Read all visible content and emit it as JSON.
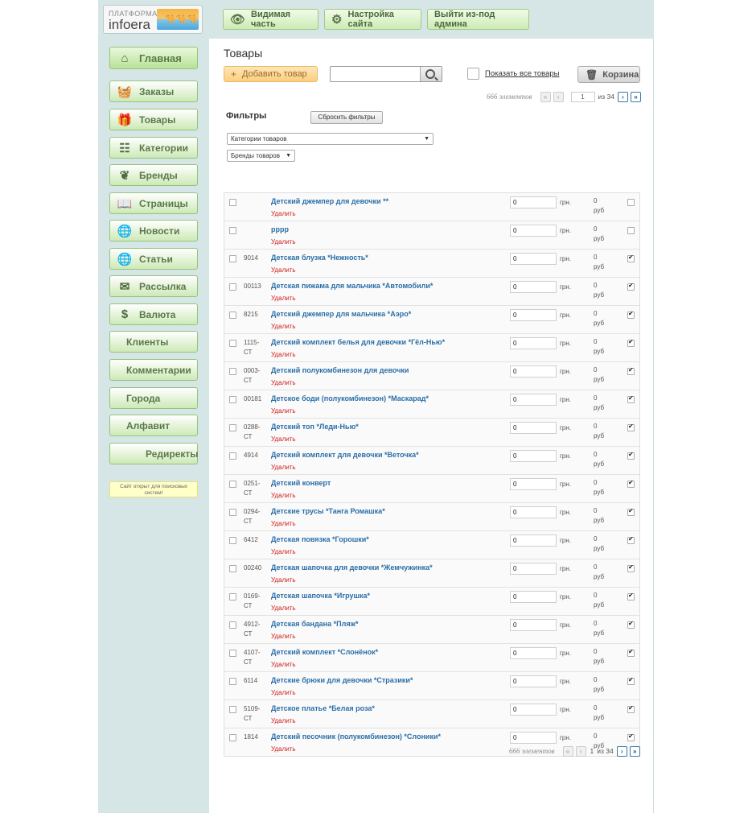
{
  "logo": {
    "line1": "ПЛАТФОРМА",
    "line2": "infoera"
  },
  "topbar": {
    "visible_label": "Видимая часть",
    "settings_label": "Настройка сайта",
    "logout_label": "Выйти из-под админа"
  },
  "sidebar": {
    "items": [
      {
        "label": "Главная",
        "icon": "home-icon"
      },
      {
        "label": "Заказы",
        "icon": "basket-icon"
      },
      {
        "label": "Товары",
        "icon": "gift-icon"
      },
      {
        "label": "Категории",
        "icon": "tree-icon"
      },
      {
        "label": "Бренды",
        "icon": "leaf-icon"
      },
      {
        "label": "Страницы",
        "icon": "book-icon"
      },
      {
        "label": "Новости",
        "icon": "globe-icon"
      },
      {
        "label": "Статьи",
        "icon": "globe-icon"
      },
      {
        "label": "Рассылка",
        "icon": "envelope-icon"
      },
      {
        "label": "Валюта",
        "icon": "dollar-icon"
      },
      {
        "label": "Клиенты"
      },
      {
        "label": "Комментарии"
      },
      {
        "label": "Города"
      },
      {
        "label": "Алфавит"
      },
      {
        "label": "Редиректы"
      }
    ],
    "seo_notice": "Сайт открыт для поисковых систем!"
  },
  "main": {
    "title": "Товары",
    "add_label": "Добавить товар",
    "search_value": "",
    "show_all_label": "Показать все товары",
    "cart_label": "Корзина",
    "pager_top": {
      "count": "666 элементов",
      "page": "1",
      "of": "из 34"
    },
    "pager_bottom": {
      "count": "666 элементов",
      "page": "1",
      "of": "из 34"
    },
    "pager_glyphs": {
      "first": "«",
      "prev": "‹",
      "next": "›",
      "last": "»"
    },
    "filters_title": "Фильтры",
    "reset_label": "Сбросить фильтры",
    "categories_select": "Категории товаров",
    "brands_select": "Бренды товаров",
    "delete_label": "Удалить",
    "currency1": "грн.",
    "currency2": "руб",
    "products": [
      {
        "sku": "",
        "name": "Детский джемпер для девочки **",
        "price": "0",
        "rub": "0",
        "checked": false
      },
      {
        "sku": "",
        "name": "рррр",
        "price": "0",
        "rub": "0",
        "checked": false
      },
      {
        "sku": "9014",
        "name": "Детская блузка *Нежность*",
        "price": "0",
        "rub": "0",
        "checked": true
      },
      {
        "sku": "00113",
        "name": "Детская пижама для мальчика *Автомобили*",
        "price": "0",
        "rub": "0",
        "checked": true
      },
      {
        "sku": "8215",
        "name": "Детский джемпер для мальчика *Аэро*",
        "price": "0",
        "rub": "0",
        "checked": true
      },
      {
        "sku": "1115-СТ",
        "name": "Детский комплект белья для девочки *Гёл-Нью*",
        "price": "0",
        "rub": "0",
        "checked": true
      },
      {
        "sku": "0003-СТ",
        "name": "Детский полукомбинезон для девочки",
        "price": "0",
        "rub": "0",
        "checked": true
      },
      {
        "sku": "00181",
        "name": "Детское боди (полукомбинезон) *Маскарад*",
        "price": "0",
        "rub": "0",
        "checked": true
      },
      {
        "sku": "0288-СТ",
        "name": "Детский топ *Леди-Нью*",
        "price": "0",
        "rub": "0",
        "checked": true
      },
      {
        "sku": "4914",
        "name": "Детский комплект для девочки *Веточка*",
        "price": "0",
        "rub": "0",
        "checked": true
      },
      {
        "sku": "0251-СТ",
        "name": "Детский конверт",
        "price": "0",
        "rub": "0",
        "checked": true
      },
      {
        "sku": "0294-СТ",
        "name": "Детские трусы *Танга Ромашка*",
        "price": "0",
        "rub": "0",
        "checked": true
      },
      {
        "sku": "6412",
        "name": "Детская повязка *Горошки*",
        "price": "0",
        "rub": "0",
        "checked": true
      },
      {
        "sku": "00240",
        "name": "Детская шапочка для девочки *Жемчужинка*",
        "price": "0",
        "rub": "0",
        "checked": true
      },
      {
        "sku": "0169-СТ",
        "name": "Детская шапочка *Игрушка*",
        "price": "0",
        "rub": "0",
        "checked": true
      },
      {
        "sku": "4912-СТ",
        "name": "Детская бандана *Пляж*",
        "price": "0",
        "rub": "0",
        "checked": true
      },
      {
        "sku": "4107-СТ",
        "name": "Детский комплект *Слонёнок*",
        "price": "0",
        "rub": "0",
        "checked": true
      },
      {
        "sku": "6114",
        "name": "Детские брюки для девочки *Стразики*",
        "price": "0",
        "rub": "0",
        "checked": true
      },
      {
        "sku": "5109-СТ",
        "name": "Детское платье *Белая роза*",
        "price": "0",
        "rub": "0",
        "checked": true
      },
      {
        "sku": "1814",
        "name": "Детский песочник (полукомбинезон) *Слоники*",
        "price": "0",
        "rub": "0",
        "checked": true
      }
    ]
  }
}
